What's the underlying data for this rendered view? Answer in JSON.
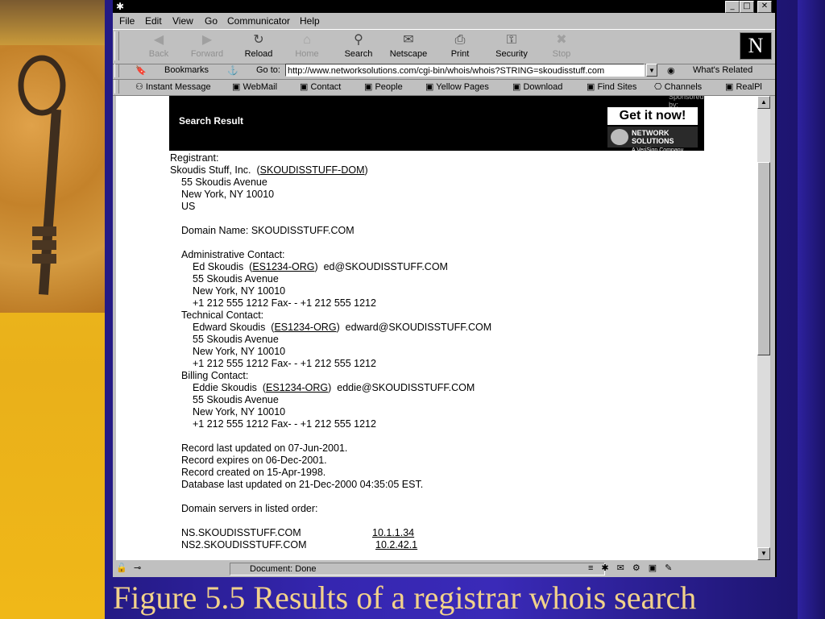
{
  "menubar": [
    "File",
    "Edit",
    "View",
    "Go",
    "Communicator",
    "Help"
  ],
  "nav_toolbar": [
    {
      "label": "Back",
      "icon": "back-arrow-icon",
      "enabled": false
    },
    {
      "label": "Forward",
      "icon": "forward-arrow-icon",
      "enabled": false
    },
    {
      "label": "Reload",
      "icon": "reload-icon",
      "enabled": true
    },
    {
      "label": "Home",
      "icon": "home-icon",
      "enabled": false
    },
    {
      "label": "Search",
      "icon": "search-icon",
      "enabled": true
    },
    {
      "label": "Netscape",
      "icon": "netscape-icon",
      "enabled": true
    },
    {
      "label": "Print",
      "icon": "print-icon",
      "enabled": true
    },
    {
      "label": "Security",
      "icon": "lock-icon",
      "enabled": true
    },
    {
      "label": "Stop",
      "icon": "stop-icon",
      "enabled": false
    }
  ],
  "location": {
    "bookmarks_label": "Bookmarks",
    "goto_label": "Go to:",
    "url": "http://www.networksolutions.com/cgi-bin/whois/whois?STRING=skoudisstuff.com",
    "whats_related": "What's Related"
  },
  "personal_toolbar": [
    "Instant Message",
    "WebMail",
    "Contact",
    "People",
    "Yellow Pages",
    "Download",
    "Find Sites",
    "Channels",
    "RealPl"
  ],
  "banner": {
    "title": "Search Result",
    "sponsored": "Sponsored by:",
    "get_it_now": "Get it now!",
    "network_solutions": "NETWORK SOLUTIONS",
    "tagline": "A VeriSign Company"
  },
  "whois": {
    "registrant_label": "Registrant:",
    "registrant_name": "Skoudis Stuff, Inc.  (",
    "registrant_handle": "SKOUDISSTUFF-DOM",
    "registrant_addr1": "55 Skoudis Avenue",
    "registrant_addr2": "New York, NY 10010",
    "registrant_country": "US",
    "domain_name": "Domain Name: SKOUDISSTUFF.COM",
    "admin_label": "Administrative Contact:",
    "admin_name": "Ed Skoudis  (",
    "admin_handle": "ES1234-ORG",
    "admin_email": ")  ed@SKOUDISSTUFF.COM",
    "admin_addr1": "55 Skoudis Avenue",
    "admin_addr2": "New York, NY 10010",
    "admin_phone": "+1 212 555 1212 Fax- - +1 212 555 1212",
    "tech_label": "Technical Contact:",
    "tech_name": "Edward Skoudis  (",
    "tech_handle": "ES1234-ORG",
    "tech_email": ")  edward@SKOUDISSTUFF.COM",
    "tech_addr1": "55 Skoudis Avenue",
    "tech_addr2": "New York, NY 10010",
    "tech_phone": "+1 212 555 1212 Fax- - +1 212 555 1212",
    "billing_label": "Billing Contact:",
    "billing_name": "Eddie Skoudis  (",
    "billing_handle": "ES1234-ORG",
    "billing_email": ")  eddie@SKOUDISSTUFF.COM",
    "billing_addr1": "55 Skoudis Avenue",
    "billing_addr2": "New York, NY 10010",
    "billing_phone": "+1 212 555 1212 Fax- - +1 212 555 1212",
    "updated": "Record last updated on 07-Jun-2001.",
    "expires": "Record expires on 06-Dec-2001.",
    "created": "Record created on 15-Apr-1998.",
    "db_updated": "Database last updated on 21-Dec-2000 04:35:05 EST.",
    "servers_label": "Domain servers in listed order:",
    "ns1_name": "NS.SKOUDISSTUFF.COM",
    "ns1_ip": "10.1.1.34",
    "ns2_name": "NS2.SKOUDISSTUFF.COM",
    "ns2_ip": "10.2.42.1"
  },
  "status": "Document: Done",
  "caption": "Figure 5.5 Results of a registrar whois search"
}
